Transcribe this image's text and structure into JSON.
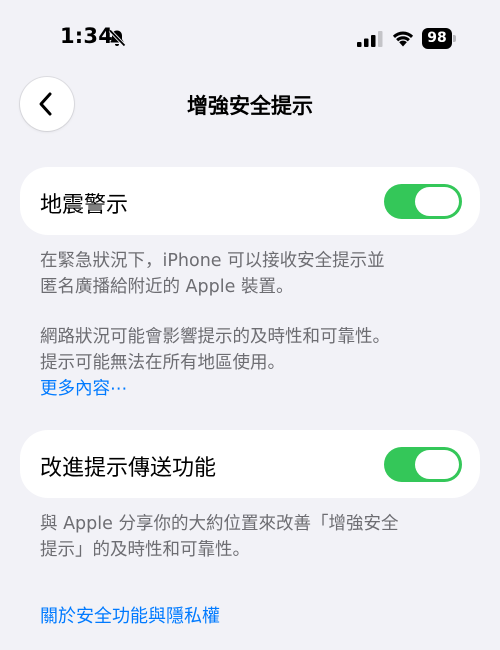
{
  "status_bar": {
    "time": "1:34",
    "battery_level": "98",
    "icons": [
      "bell-slash-icon",
      "cellular-signal-icon",
      "wifi-icon",
      "battery-icon"
    ]
  },
  "nav": {
    "title": "增強安全提示",
    "back_icon": "chevron-left-icon"
  },
  "earthquake": {
    "label": "地震警示",
    "enabled": true,
    "footer_line1": "在緊急狀況下，iPhone 可以接收安全提示並",
    "footer_line2": "匿名廣播給附近的 Apple 裝置。",
    "footer_line3": "網路狀況可能會影響提示的及時性和可靠性。",
    "footer_line4": "提示可能無法在所有地區使用。",
    "more_link": "更多內容⋯"
  },
  "improve": {
    "label": "改進提示傳送功能",
    "enabled": true,
    "footer_line1": "與 Apple 分享你的大約位置來改善「增強安全",
    "footer_line2": "提示」的及時性和可靠性。"
  },
  "about_link": "關於安全功能與隱私權",
  "colors": {
    "background": "#f2f2f7",
    "toggle_on": "#34c759",
    "link": "#007aff",
    "secondary_text": "#6d6d72"
  }
}
